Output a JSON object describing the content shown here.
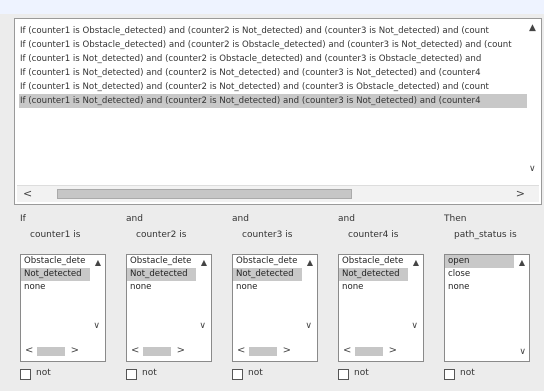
{
  "rules": [
    "If (counter1 is Obstacle_detected) and (counter2 is Not_detected) and (counter3 is Not_detected) and (count",
    "If (counter1 is Obstacle_detected) and (counter2 is Obstacle_detected) and (counter3 is Not_detected) and (count",
    "If (counter1 is Not_detected) and (counter2 is Obstacle_detected) and (counter3 is Obstacle_detected) and",
    "If (counter1 is Not_detected) and (counter2 is Not_detected) and (counter3 is Not_detected) and (counter4",
    "If (counter1 is Not_detected) and (counter2 is Not_detected) and (counter3 is Obstacle_detected) and (count",
    "If (counter1 is Not_detected) and (counter2 is Not_detected) and (counter3 is Not_detected) and (counter4"
  ],
  "selected_rule_index": 5,
  "columns": [
    {
      "prefix": "If",
      "label": "counter1 is",
      "options": [
        "Obstacle_dete",
        "Not_detected",
        "none"
      ],
      "selected": 1,
      "not_label": "not"
    },
    {
      "prefix": "and",
      "label": "counter2 is",
      "options": [
        "Obstacle_dete",
        "Not_detected",
        "none"
      ],
      "selected": 1,
      "not_label": "not"
    },
    {
      "prefix": "and",
      "label": "counter3 is",
      "options": [
        "Obstacle_dete",
        "Not_detected",
        "none"
      ],
      "selected": 1,
      "not_label": "not"
    },
    {
      "prefix": "and",
      "label": "counter4 is",
      "options": [
        "Obstacle_dete",
        "Not_detected",
        "none"
      ],
      "selected": 1,
      "not_label": "not"
    },
    {
      "prefix": "Then",
      "label": "path_status is",
      "options": [
        "open",
        "close",
        "none"
      ],
      "selected": 0,
      "not_label": "not"
    }
  ],
  "colors": {
    "selection": "#c8c8c8",
    "title_blue": "#1a77d9"
  }
}
